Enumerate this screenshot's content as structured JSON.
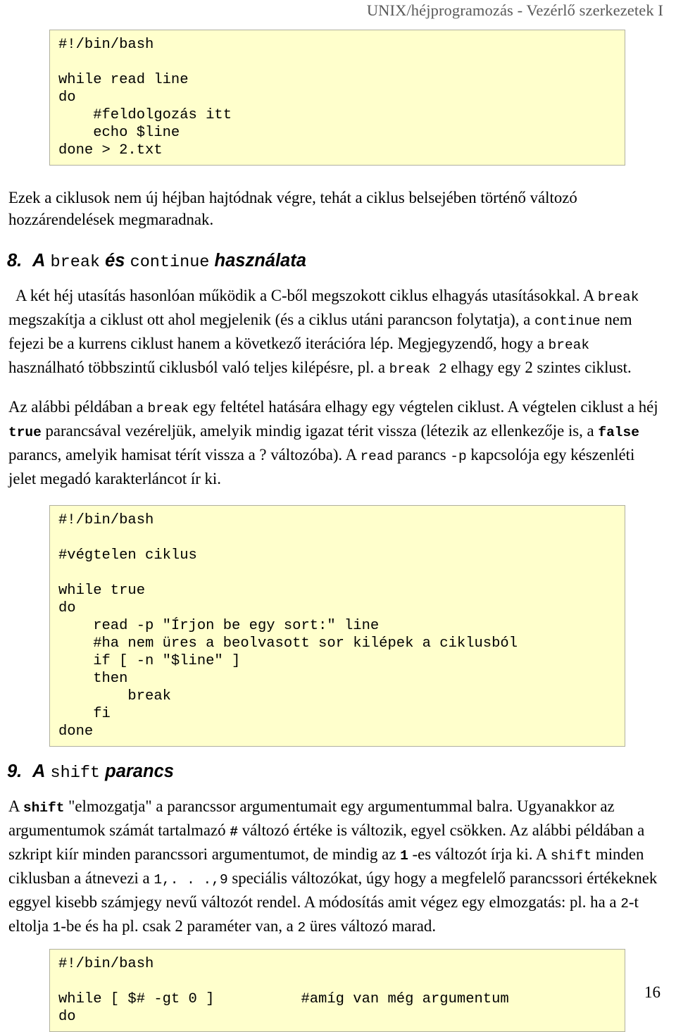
{
  "header": {
    "running_head": "UNIX/héjprogramozás - Vezérlő szerkezetek I"
  },
  "page_number": "16",
  "code_blocks": {
    "block1": "#!/bin/bash\n\nwhile read line\ndo\n    #feldolgozás itt\n    echo $line\ndone > 2.txt",
    "block2": "#!/bin/bash\n\n#végtelen ciklus\n\nwhile true\ndo\n    read -p \"Írjon be egy sort:\" line\n    #ha nem üres a beolvasott sor kilépek a ciklusból\n    if [ -n \"$line\" ]\n    then\n        break\n    fi\ndone",
    "block3": "#!/bin/bash\n\nwhile [ $# -gt 0 ]          #amíg van még argumentum\ndo"
  },
  "paragraphs": {
    "p1": "Ezek a ciklusok nem új héjban hajtódnak végre, tehát a ciklus belsejében történő változó hozzárendelések megmaradnak.",
    "p2_a": "A két héj utasítás hasonlóan működik a C-ből megszokott ciklus elhagyás utasításokkal. A ",
    "p2_break1": "break",
    "p2_b": " megszakítja a ciklust ott ahol megjelenik (és a ciklus utáni parancson folytatja), a ",
    "p2_continue": "continue",
    "p2_c": " nem fejezi be a kurrens ciklust hanem a következő iterációra lép. Megjegyzendő, hogy a ",
    "p2_break2": "break",
    "p2_d": " használható többszintű ciklusból való teljes kilépésre, pl. a ",
    "p2_break3": "break 2",
    "p2_e": " elhagy egy 2 szintes ciklust.",
    "p3_a": "Az alábbi példában a ",
    "p3_break": "break",
    "p3_b": " egy feltétel hatására elhagy egy végtelen ciklust. A végtelen ciklust a héj ",
    "p3_true": "true",
    "p3_c": " parancsával vezéreljük, amelyik mindig igazat térit vissza (létezik az ellenkezője is, a ",
    "p3_false": "false",
    "p3_d": " parancs, amelyik hamisat térít vissza a ",
    "p3_q": "?",
    "p3_e": " változóba). A ",
    "p3_read": "read",
    "p3_f": " parancs ",
    "p3_p": "-p",
    "p3_g": " kapcsolója egy készenléti jelet megadó karakterláncot ír ki.",
    "p4_a": "A ",
    "p4_shift1": "shift",
    "p4_b": " \"elmozgatja\" a parancssor argumentumait egy argumentummal balra. Ugyanakkor az argumentumok számát tartalmazó ",
    "p4_hash": "#",
    "p4_c": " változó értéke is változik, egyel csökken. Az alábbi példában a szkript kiír minden parancssori argumentumot, de mindig az ",
    "p4_one": "1",
    "p4_d": " -es változót írja ki. A ",
    "p4_shift2": "shift",
    "p4_e": " minden ciklusban a átnevezi a ",
    "p4_range": "1,. . .,9",
    "p4_f": " speciális változókat, úgy hogy a megfelelő parancssori értékeknek eggyel kisebb számjegy nevű változót rendel. A módosítás amit végez egy elmozgatás: pl. ha a ",
    "p4_two": "2",
    "p4_g": "-t eltolja ",
    "p4_one2": "1",
    "p4_h": "-be és ha pl. csak 2 paraméter van, a ",
    "p4_two2": "2",
    "p4_i": " üres változó marad."
  },
  "headings": {
    "h8_num": "8.",
    "h8_a": "A",
    "h8_mono1": "break",
    "h8_b": "és",
    "h8_mono2": "continue",
    "h8_c": "használata",
    "h9_num": "9.",
    "h9_a": "A",
    "h9_mono1": "shift",
    "h9_b": "parancs"
  },
  "colors": {
    "code_background": "#ffffcc",
    "code_border": "#b0b0a0",
    "header_text": "#595959",
    "body_text": "#000000"
  }
}
